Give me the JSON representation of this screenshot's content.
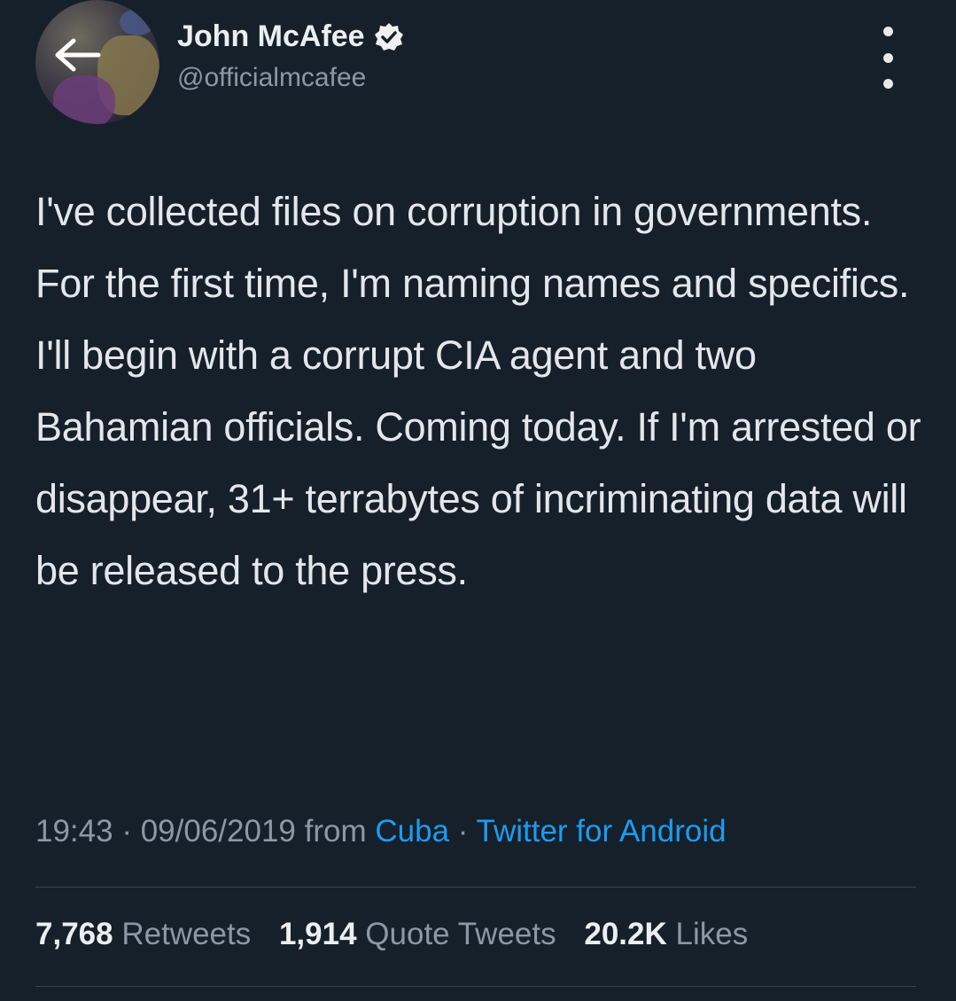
{
  "user": {
    "display_name": "John McAfee",
    "handle": "@officialmcafee",
    "verified_icon": "verified-badge-icon"
  },
  "nav": {
    "back_icon": "arrow-left-icon",
    "more_icon": "more-vertical-icon"
  },
  "tweet": {
    "text": "I've collected files on corruption in governments. For the first time, I'm naming names and specifics. I'll begin with a corrupt CIA agent and two Bahamian officials. Coming today. If I'm arrested or disappear, 31+ terrabytes of incriminating data will be released to the press.",
    "time": "19:43",
    "separator": "·",
    "date": "09/06/2019",
    "from_label": "from",
    "location": "Cuba",
    "source": "Twitter for Android"
  },
  "stats": {
    "retweets_count": "7,768",
    "retweets_label": "Retweets",
    "quotes_count": "1,914",
    "quotes_label": "Quote Tweets",
    "likes_count": "20.2K",
    "likes_label": "Likes"
  },
  "colors": {
    "background": "#15202b",
    "link": "#1d9bf0",
    "secondary_text": "#8b98a5",
    "verified": "#ffffff"
  }
}
